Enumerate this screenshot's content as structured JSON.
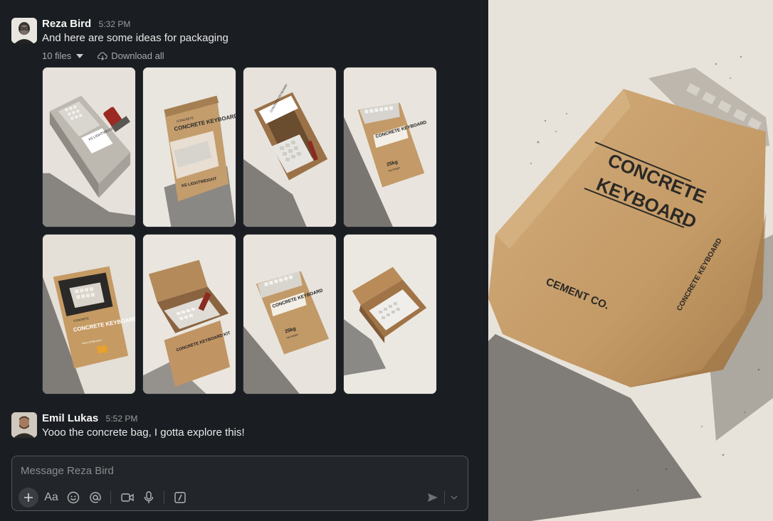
{
  "messages": [
    {
      "sender": "Reza Bird",
      "time": "5:32 PM",
      "text": "And here are some ideas for packaging",
      "files": {
        "count_label": "10 files",
        "download_label": "Download all"
      }
    },
    {
      "sender": "Emil Lukas",
      "time": "5:52 PM",
      "text": "Yooo the concrete bag, I gotta explore this!"
    }
  ],
  "thumbnails": [
    {
      "label": "XS LIGHTWEIGHT",
      "kind": "concrete-box"
    },
    {
      "label": "CONCRETE KEYBOARD",
      "sub": "XS LIGHTWEIGHT",
      "kind": "kraft-bag"
    },
    {
      "label": "CONCRETE KEYBOARD",
      "kind": "drawer-box"
    },
    {
      "label": "CONCRETE KEYBOARD",
      "sub": "25kg",
      "sub2": "Net Weight",
      "kind": "kraft-bag-small"
    },
    {
      "label": "CONCRETE KEYBOARD",
      "sub": "HIGH STRENGTH",
      "brand": "CONCRETE",
      "kind": "poster-box"
    },
    {
      "label": "CONCRETE KEYBOARD KIT",
      "kind": "open-box"
    },
    {
      "label": "CONCRETE KEYBOARD",
      "sub": "25kg",
      "sub2": "Net Weight",
      "kind": "kraft-bag-small"
    },
    {
      "label": "",
      "kind": "open-tray"
    }
  ],
  "composer": {
    "placeholder": "Message Reza Bird",
    "tools": [
      "plus-icon",
      "format-text-icon",
      "emoji-icon",
      "mention-icon",
      "video-icon",
      "microphone-icon",
      "slash-command-icon",
      "send-icon",
      "chevron-down-icon"
    ],
    "format_label": "Aa"
  },
  "hero": {
    "title_line1": "CONCRETE",
    "title_line2": "KEYBOARD",
    "brand": "CEMENT CO.",
    "side_text": "CONCRETE KEYBOARD"
  },
  "colors": {
    "background": "#1a1d21",
    "kraft": "#c9a374",
    "concrete": "#cfcac3",
    "paper": "#e9e4dc"
  }
}
